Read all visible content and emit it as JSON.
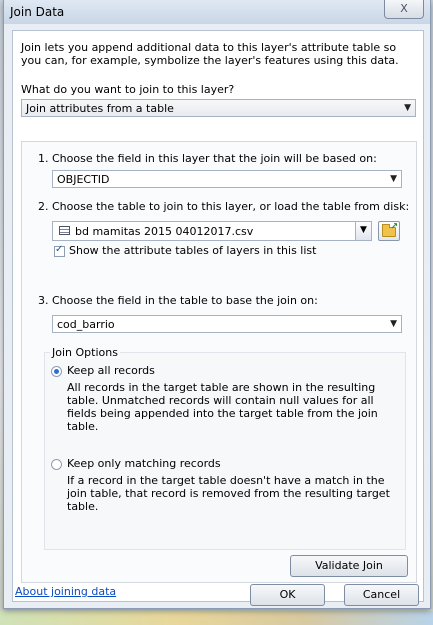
{
  "dialog": {
    "title": "Join Data",
    "close_label": "X",
    "intro": "Join lets you append additional data to this layer's attribute table so you can, for example, symbolize the layer's features using this data.",
    "join_question": "What do you want to join to this layer?",
    "join_type_value": "Join attributes from a table",
    "step1_label": "1.  Choose the field in this layer that the join will be based on:",
    "step1_value": "OBJECTID",
    "step2_label": "2.  Choose the table to join to this layer, or load the table from disk:",
    "step2_value": "bd mamitas 2015 04012017.csv",
    "show_tables_label": "Show the attribute tables of layers in this list",
    "show_tables_checked": true,
    "step3_label": "3.  Choose the field in the table to base the join on:",
    "step3_value": "cod_barrio",
    "join_options_label": "Join Options",
    "keep_all_label": "Keep all records",
    "keep_all_desc": "All records in the target table are shown in the resulting table. Unmatched records will contain null values for all fields being appended into the target table from the join table.",
    "keep_matching_label": "Keep only matching records",
    "keep_matching_desc": "If a record in the target table doesn't have a match in the join table, that record is removed from the resulting target table.",
    "selected_option": "keep_all",
    "validate_label": "Validate Join",
    "about_link": "About joining data",
    "ok_label": "OK",
    "cancel_label": "Cancel"
  },
  "icons": {
    "table": "table-icon",
    "open_folder": "open-folder-icon",
    "dropdown": "chevron-down-icon"
  }
}
